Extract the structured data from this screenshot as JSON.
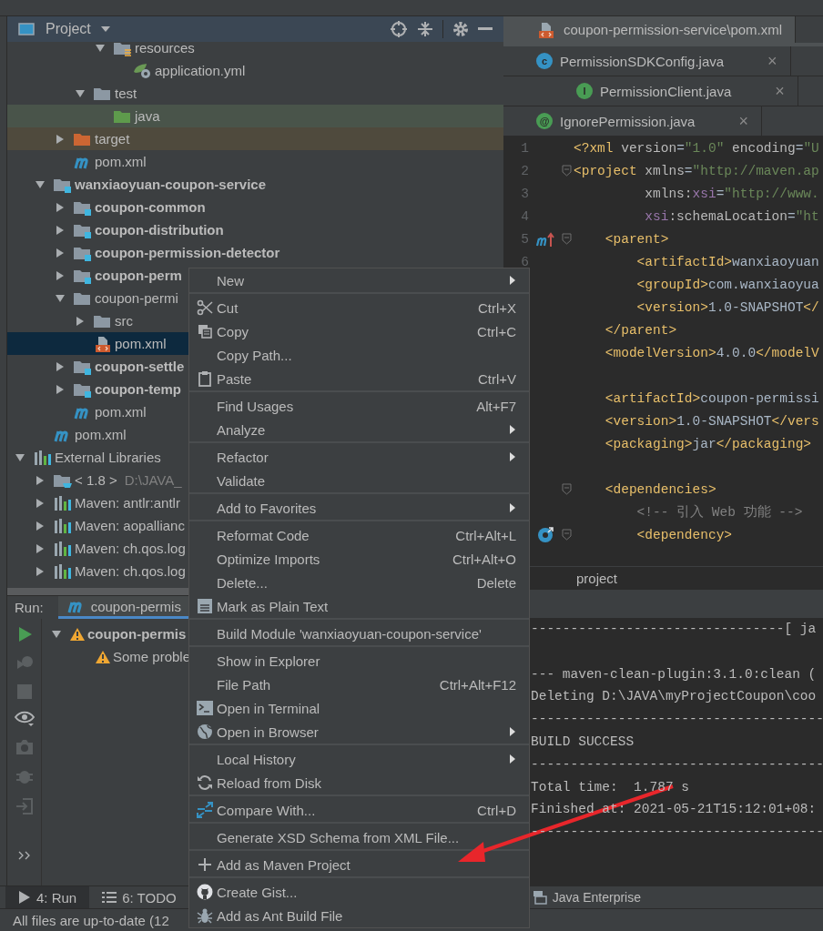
{
  "project_panel": {
    "title": "Project",
    "tree": [
      {
        "children": [
          {
            "children": [
              {
                "children": [
                  {
                    "children": [
                      {
                        "label": "resources",
                        "kind": "resource-folder",
                        "expanded": true,
                        "selected": false,
                        "children": [
                          {
                            "label": "application.yml",
                            "kind": "yml",
                            "selected": false
                          }
                        ]
                      }
                    ]
                  },
                  {
                    "label": "test",
                    "kind": "folder",
                    "expanded": true,
                    "selected": false,
                    "children": [
                      {
                        "label": "java",
                        "kind": "test-source",
                        "selected": false
                      }
                    ]
                  }
                ]
              },
              {
                "label": "target",
                "kind": "excluded",
                "expanded": false,
                "selected": false
              },
              {
                "label": "pom.xml",
                "kind": "maven-pom",
                "selected": false
              }
            ]
          },
          {
            "label": "wanxiaoyuan-coupon-service",
            "kind": "module",
            "expanded": true,
            "selected": false,
            "children": [
              {
                "label": "coupon-common",
                "kind": "module",
                "expanded": false,
                "selected": false
              },
              {
                "label": "coupon-distribution",
                "kind": "module",
                "expanded": false,
                "selected": false
              },
              {
                "label": "coupon-permission-detector",
                "kind": "module",
                "expanded": false,
                "selected": false
              },
              {
                "label": "coupon-perm",
                "kind": "module",
                "expanded": false,
                "selected": false
              },
              {
                "label": "coupon-permi",
                "kind": "folder",
                "expanded": true,
                "selected": false,
                "children": [
                  {
                    "label": "src",
                    "kind": "folder",
                    "expanded": false,
                    "selected": false
                  },
                  {
                    "label": "pom.xml",
                    "kind": "xml",
                    "selected": true
                  }
                ]
              },
              {
                "label": "coupon-settle",
                "kind": "module",
                "expanded": false,
                "selected": false
              },
              {
                "label": "coupon-temp",
                "kind": "module",
                "expanded": false,
                "selected": false
              },
              {
                "label": "pom.xml",
                "kind": "maven-pom",
                "selected": false
              }
            ]
          },
          {
            "label": "pom.xml",
            "kind": "maven-pom",
            "selected": false
          }
        ]
      },
      {
        "label": "External Libraries",
        "kind": "libraries",
        "expanded": true,
        "selected": false,
        "children": [
          {
            "label": "< 1.8 >",
            "detail": "D:\\JAVA_",
            "kind": "jdk",
            "expanded": false,
            "selected": false
          },
          {
            "label": "Maven: antlr:antlr",
            "kind": "library",
            "expanded": false,
            "selected": false
          },
          {
            "label": "Maven: aopallianc",
            "kind": "library",
            "expanded": false,
            "selected": false
          },
          {
            "label": "Maven: ch.qos.log",
            "kind": "library",
            "expanded": false,
            "selected": false
          },
          {
            "label": "Maven: ch.qos.log",
            "kind": "library",
            "expanded": false,
            "selected": false
          }
        ]
      }
    ]
  },
  "editor": {
    "tab_rows": [
      [
        {
          "label": "coupon-permission-service\\pom.xml",
          "kind": "xml",
          "selected": true
        }
      ],
      [
        {
          "label": "PermissionSDKConfig.java",
          "kind": "class",
          "badge": "c",
          "color": "#3592c4",
          "close": "×",
          "selected": false
        }
      ],
      [
        {
          "label": "PermissionClient.java",
          "kind": "class",
          "badge": "I",
          "color": "#499c54",
          "close": "×",
          "selected": false
        }
      ],
      [
        {
          "label": "IgnorePermission.java",
          "kind": "class",
          "badge": "@",
          "color": "#499c54",
          "close": "×",
          "selected": false
        }
      ]
    ],
    "lines": [
      {
        "number": "1",
        "tokens": [
          {
            "kind": "tag",
            "text": "<?xml "
          },
          {
            "kind": "attr",
            "text": "version"
          },
          {
            "kind": "plain",
            "text": "="
          },
          {
            "kind": "value",
            "text": "\"1.0\" "
          },
          {
            "kind": "attr",
            "text": "encoding"
          },
          {
            "kind": "plain",
            "text": "="
          },
          {
            "kind": "value",
            "text": "\"U"
          }
        ]
      },
      {
        "number": "2",
        "fold": true,
        "tokens": [
          {
            "kind": "tag",
            "text": "<project "
          },
          {
            "kind": "attr",
            "text": "xmlns"
          },
          {
            "kind": "plain",
            "text": "="
          },
          {
            "kind": "value",
            "text": "\"http://maven.ap"
          }
        ]
      },
      {
        "number": "3",
        "tokens": [
          {
            "kind": "attr",
            "text": "         xmlns:"
          },
          {
            "kind": "ns",
            "text": "xsi"
          },
          {
            "kind": "plain",
            "text": "="
          },
          {
            "kind": "value",
            "text": "\"http://www."
          }
        ]
      },
      {
        "number": "4",
        "tokens": [
          {
            "kind": "ns",
            "text": "         xsi"
          },
          {
            "kind": "attr",
            "text": ":schemaLocation"
          },
          {
            "kind": "plain",
            "text": "="
          },
          {
            "kind": "value",
            "text": "\"ht"
          }
        ]
      },
      {
        "number": "5",
        "fold": true,
        "kind": "parent",
        "tokens": [
          {
            "kind": "tag",
            "text": "    <parent>"
          }
        ]
      },
      {
        "number": "6",
        "tokens": [
          {
            "kind": "tag",
            "text": "        <artifactId>"
          },
          {
            "kind": "plain",
            "text": "wanxiaoyuan"
          }
        ]
      },
      {
        "tokens": [
          {
            "kind": "tag",
            "text": "        <groupId>"
          },
          {
            "kind": "plain",
            "text": "com.wanxiaoyua"
          }
        ]
      },
      {
        "tokens": [
          {
            "kind": "tag",
            "text": "        <version>"
          },
          {
            "kind": "plain",
            "text": "1.0-SNAPSHOT"
          },
          {
            "kind": "tag",
            "text": "</"
          }
        ]
      },
      {
        "tokens": [
          {
            "kind": "tag",
            "text": "    </parent>"
          }
        ]
      },
      {
        "tokens": [
          {
            "kind": "tag",
            "text": "    <modelVersion>"
          },
          {
            "kind": "plain",
            "text": "4.0.0"
          },
          {
            "kind": "tag",
            "text": "</modelV"
          }
        ]
      },
      {
        "blank_before": true,
        "tokens": [
          {
            "kind": "tag",
            "text": "    <artifactId>"
          },
          {
            "kind": "plain",
            "text": "coupon-permissi"
          }
        ]
      },
      {
        "tokens": [
          {
            "kind": "tag",
            "text": "    <version>"
          },
          {
            "kind": "plain",
            "text": "1.0-SNAPSHOT"
          },
          {
            "kind": "tag",
            "text": "</vers"
          }
        ]
      },
      {
        "tokens": [
          {
            "kind": "tag",
            "text": "    <packaging>"
          },
          {
            "kind": "plain",
            "text": "jar"
          },
          {
            "kind": "tag",
            "text": "</packaging>"
          }
        ]
      },
      {
        "fold": true,
        "blank_before": true,
        "tokens": [
          {
            "kind": "tag",
            "text": "    <dependencies>"
          }
        ]
      },
      {
        "tokens": [
          {
            "kind": "comment",
            "text": "        <!-- 引入 Web 功能 -->"
          }
        ]
      },
      {
        "fold": true,
        "kind": "dependency",
        "tokens": [
          {
            "kind": "tag",
            "text": "        <dependency>"
          }
        ]
      }
    ],
    "breadcrumb": "project"
  },
  "run_panel": {
    "title": "Run:",
    "tab": {
      "label": "coupon-permis",
      "selected": true
    },
    "tree": [
      {
        "label": "coupon-permis",
        "expanded": true,
        "children": [
          {
            "label": "Some proble"
          }
        ]
      }
    ]
  },
  "console": [
    {
      "text": "--------------------------------[ ja"
    },
    {
      "text": "--- maven-clean-plugin:3.1.0:clean (",
      "blank_before": true
    },
    {
      "text": "Deleting D:\\JAVA\\myProjectCoupon\\coo"
    },
    {
      "text": "-------------------------------------"
    },
    {
      "text": "BUILD SUCCESS"
    },
    {
      "text": "-------------------------------------"
    },
    {
      "text": "Total time:  1.787 s"
    },
    {
      "text": "Finished at: 2021-05-21T15:12:01+08:"
    },
    {
      "text": "-------------------------------------"
    }
  ],
  "context_menu": [
    {
      "kind": "item",
      "label": "New",
      "submenu": true
    },
    {
      "kind": "separator"
    },
    {
      "kind": "item",
      "label": "Cut",
      "shortcut": "Ctrl+X"
    },
    {
      "kind": "item",
      "label": "Copy",
      "shortcut": "Ctrl+C"
    },
    {
      "kind": "item",
      "label": "Copy Path..."
    },
    {
      "kind": "item",
      "label": "Paste",
      "shortcut": "Ctrl+V"
    },
    {
      "kind": "separator"
    },
    {
      "kind": "item",
      "label": "Find Usages",
      "shortcut": "Alt+F7"
    },
    {
      "kind": "item",
      "label": "Analyze",
      "submenu": true
    },
    {
      "kind": "separator"
    },
    {
      "kind": "item",
      "label": "Refactor",
      "submenu": true
    },
    {
      "kind": "item",
      "label": "Validate"
    },
    {
      "kind": "separator"
    },
    {
      "kind": "item",
      "label": "Add to Favorites",
      "submenu": true
    },
    {
      "kind": "separator"
    },
    {
      "kind": "item",
      "label": "Reformat Code",
      "shortcut": "Ctrl+Alt+L"
    },
    {
      "kind": "item",
      "label": "Optimize Imports",
      "shortcut": "Ctrl+Alt+O"
    },
    {
      "kind": "item",
      "label": "Delete...",
      "shortcut": "Delete"
    },
    {
      "kind": "item",
      "label": "Mark as Plain Text"
    },
    {
      "kind": "separator"
    },
    {
      "kind": "item",
      "label": "Build Module 'wanxiaoyuan-coupon-service'"
    },
    {
      "kind": "separator"
    },
    {
      "kind": "item",
      "label": "Show in Explorer"
    },
    {
      "kind": "item",
      "label": "File Path",
      "shortcut": "Ctrl+Alt+F12"
    },
    {
      "kind": "item",
      "label": "Open in Terminal"
    },
    {
      "kind": "item",
      "label": "Open in Browser",
      "submenu": true
    },
    {
      "kind": "separator"
    },
    {
      "kind": "item",
      "label": "Local History",
      "submenu": true
    },
    {
      "kind": "item",
      "label": "Reload from Disk"
    },
    {
      "kind": "separator"
    },
    {
      "kind": "item",
      "label": "Compare With...",
      "shortcut": "Ctrl+D"
    },
    {
      "kind": "separator"
    },
    {
      "kind": "item",
      "label": "Generate XSD Schema from XML File..."
    },
    {
      "kind": "separator"
    },
    {
      "kind": "item",
      "label": "Add as Maven Project"
    },
    {
      "kind": "separator"
    },
    {
      "kind": "item",
      "label": "Create Gist..."
    },
    {
      "kind": "item",
      "label": "Add as Ant Build File"
    }
  ],
  "tool_tabs": [
    {
      "label": "4: Run",
      "kind": "run",
      "selected": true
    },
    {
      "label": "6: TODO",
      "kind": "todo",
      "selected": false
    }
  ],
  "tool_tabs_right": [
    {
      "label": "Java Enterprise"
    }
  ],
  "status_bar": "All files are up-to-date (12"
}
